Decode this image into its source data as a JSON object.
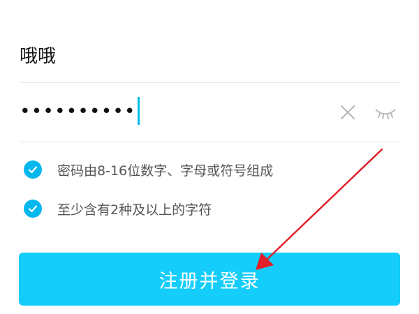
{
  "form": {
    "username": "哦哦",
    "password_masked": "••••••••••",
    "rules": [
      {
        "text": "密码由8-16位数字、字母或符号组成",
        "checked": true
      },
      {
        "text": "至少含有2种及以上的字符",
        "checked": true
      }
    ],
    "submit_label": "注册并登录"
  },
  "icons": {
    "clear": "close-icon",
    "visibility": "eye-closed-icon",
    "check": "check-circle-icon"
  },
  "colors": {
    "accent": "#00b7ee",
    "button": "#14cdfa",
    "annotation_arrow": "#e0202b"
  }
}
